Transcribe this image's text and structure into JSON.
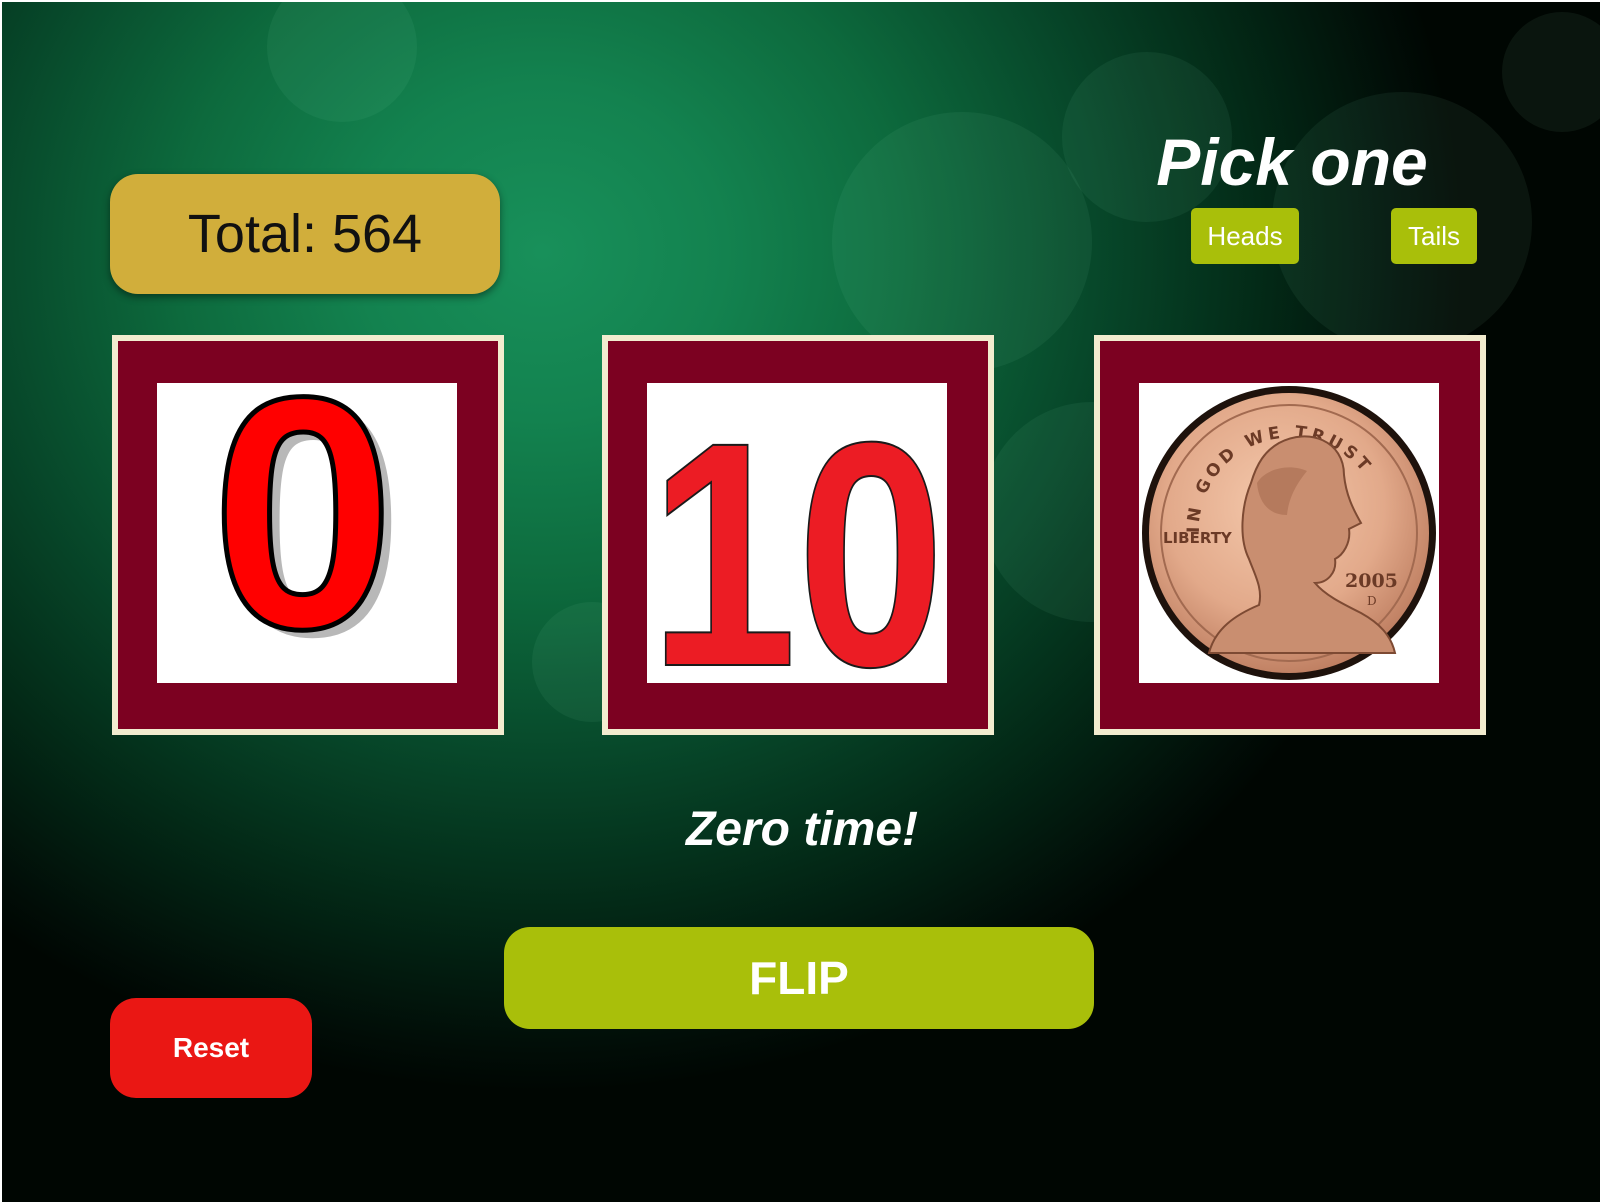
{
  "total": {
    "text": "Total: 564"
  },
  "pick": {
    "title": "Pick one",
    "heads_label": "Heads",
    "tails_label": "Tails"
  },
  "tiles": [
    {
      "kind": "number",
      "value": "0"
    },
    {
      "kind": "number",
      "value": "10"
    },
    {
      "kind": "coin",
      "coin_text": {
        "motto": "IN GOD WE TRUST",
        "liberty": "LIBERTY",
        "year": "2005",
        "mint": "D"
      }
    }
  ],
  "result": {
    "message": "Zero time!"
  },
  "controls": {
    "flip_label": "FLIP",
    "reset_label": "Reset"
  },
  "colors": {
    "accent_green": "#a9bf0a",
    "total_gold": "#d1ae3b",
    "tile_frame": "#7c0121",
    "tile_border": "#f2eccf",
    "reset_red": "#ea1714",
    "digit_red": "#ff0000",
    "digit_red_alt": "#ec1c24"
  }
}
